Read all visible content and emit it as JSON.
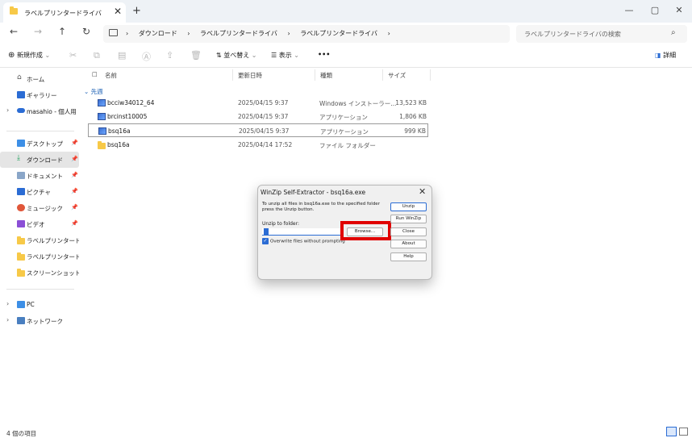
{
  "tab": {
    "title": "ラベルプリンタードライバ",
    "close": "✕",
    "new": "+"
  },
  "window": {
    "minimize": "—",
    "maximize": "▢",
    "close": "✕"
  },
  "nav": {
    "back": "←",
    "forward": "→",
    "up": "↑",
    "refresh": "↻"
  },
  "address": {
    "crumbs": [
      "ダウンロード",
      "ラベルプリンタードライバ",
      "ラベルプリンタードライバ"
    ]
  },
  "search": {
    "placeholder": "ラベルプリンタードライバの検索"
  },
  "toolbar": {
    "new": "新規作成",
    "sort": "並べ替え",
    "view": "表示",
    "more": "•••",
    "details": "詳細"
  },
  "sidebar": {
    "home": "ホーム",
    "gallery": "ギャラリー",
    "onedrive": "masahio - 個人用",
    "desktop": "デスクトップ",
    "downloads": "ダウンロード",
    "documents": "ドキュメント",
    "pictures": "ピクチャ",
    "music": "ミュージック",
    "videos": "ビデオ",
    "folder1": "ラベルプリンタードライバ",
    "folder2": "ラベルプリンタードライバ",
    "screenshots": "スクリーンショット",
    "pc": "PC",
    "network": "ネットワーク"
  },
  "columns": {
    "name": "名前",
    "date": "更新日時",
    "type": "種類",
    "size": "サイズ"
  },
  "group": "先週",
  "files": [
    {
      "name": "bcciw34012_64",
      "date": "2025/04/15 9:37",
      "type": "Windows インストーラー...",
      "size": "13,523 KB"
    },
    {
      "name": "brcinst10005",
      "date": "2025/04/15 9:37",
      "type": "アプリケーション",
      "size": "1,806 KB"
    },
    {
      "name": "bsq16a",
      "date": "2025/04/15 9:37",
      "type": "アプリケーション",
      "size": "999 KB"
    },
    {
      "name": "bsq16a",
      "date": "2025/04/14 17:52",
      "type": "ファイル フォルダー",
      "size": ""
    }
  ],
  "status": "4 個の項目",
  "dialog": {
    "title": "WinZip Self-Extractor - bsq16a.exe",
    "message": "To unzip all files in bsq16a.exe to the specified folder press the Unzip button.",
    "unzip_to_label": "Unzip to folder:",
    "folder_value": "",
    "overwrite_label": "Overwrite files without prompting",
    "buttons": {
      "unzip": "Unzip",
      "run_winzip": "Run WinZip",
      "close": "Close",
      "about": "About",
      "help": "Help",
      "browse": "Browse..."
    }
  },
  "colors": {
    "accent": "#2b6cd4",
    "highlight": "#e00000",
    "folder": "#f7c948"
  }
}
